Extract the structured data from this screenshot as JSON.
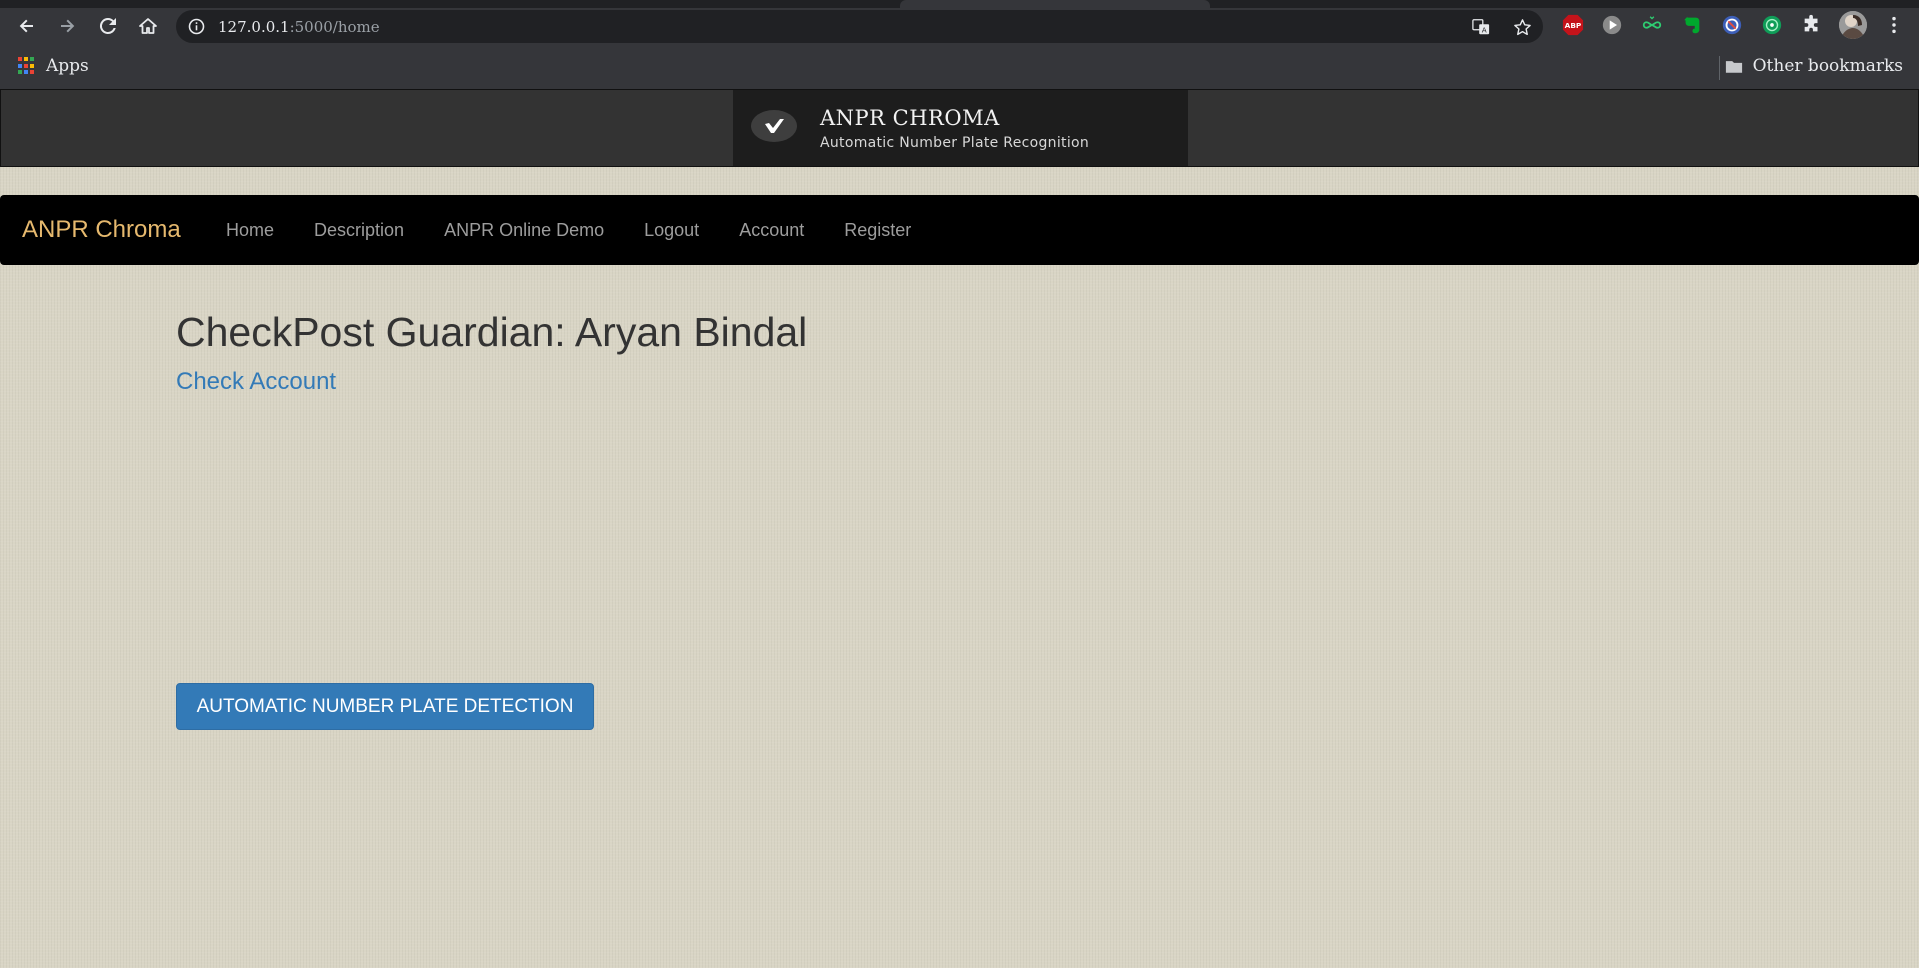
{
  "browser": {
    "url_host": "127.0.0.1",
    "url_path": ":5000/home",
    "bookmarks": {
      "apps_label": "Apps",
      "other_label": "Other bookmarks"
    },
    "extensions": [
      "abp-icon",
      "play-icon",
      "infinity-icon",
      "evernote-icon",
      "block-icon",
      "green-circle-icon",
      "puzzle-icon",
      "avatar"
    ],
    "extension_text": {
      "abp": "ABP"
    }
  },
  "banner": {
    "title": "ANPR CHROMA",
    "subtitle": "Automatic Number Plate Recognition"
  },
  "navbar": {
    "brand": "ANPR Chroma",
    "links": [
      "Home",
      "Description",
      "ANPR Online Demo",
      "Logout",
      "Account",
      "Register"
    ]
  },
  "main": {
    "heading": "CheckPost Guardian: Aryan Bindal",
    "check_account_link": "Check Account",
    "detect_button": "AUTOMATIC NUMBER PLATE DETECTION"
  },
  "colors": {
    "brand": "#e6b96e",
    "link": "#337ab7",
    "button": "#337ab7",
    "navbar_bg": "#000000",
    "page_bg": "#d9d5c5"
  }
}
